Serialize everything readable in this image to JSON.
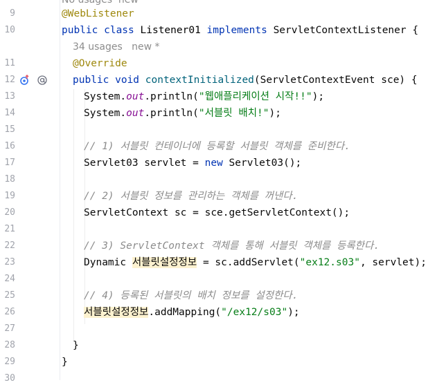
{
  "gutter": {
    "line_numbers": [
      "10",
      "",
      "11",
      "12",
      "13",
      "14",
      "15",
      "16",
      "17",
      "18",
      "19",
      "20",
      "21",
      "22",
      "23",
      "24",
      "25",
      "26",
      "27",
      "28",
      "29",
      "30"
    ]
  },
  "hints": {
    "usages": "34 usages   new *"
  },
  "code": {
    "l0": "@WebListener",
    "l1_kw1": "public class ",
    "l1_name": "Listener01 ",
    "l1_kw2": "implements ",
    "l1_rest": "ServletContextListener {",
    "l3": "@Override",
    "l4_kw": "public void ",
    "l4_fn": "contextInitialized",
    "l4_rest": "(ServletContextEvent sce) {",
    "l5_a": "System.",
    "l5_b": "out",
    "l5_c": ".println(",
    "l5_str": "\"웹애플리케이션 시작!!\"",
    "l5_end": ");",
    "l6_a": "System.",
    "l6_b": "out",
    "l6_c": ".println(",
    "l6_str": "\"서블릿 배치!\"",
    "l6_end": ");",
    "l8": "// 1) 서블릿 컨테이너에 등록할 서블릿 객체를 준비한다.",
    "l9_a": "Servlet03 servlet = ",
    "l9_kw": "new ",
    "l9_b": "Servlet03();",
    "l11": "// 2) 서블릿 정보를 관리하는 객체를 꺼낸다.",
    "l12": "ServletContext sc = sce.getServletContext();",
    "l14": "// 3) ServletContext 객체를 통해 서블릿 객체를 등록한다.",
    "l15_a": "Dynamic ",
    "l15_hl": "서블릿설정정보",
    "l15_b": " = sc.addServlet(",
    "l15_str1": "\"ex12.s03\"",
    "l15_c": ", servlet);",
    "l17": "// 4) 등록된 서블릿의 배치 정보를 설정한다.",
    "l18_hl": "서블릿설정정보",
    "l18_a": ".addMapping(",
    "l18_str": "\"/ex12/s03\"",
    "l18_b": ");",
    "l20": "}",
    "l21": "}"
  }
}
